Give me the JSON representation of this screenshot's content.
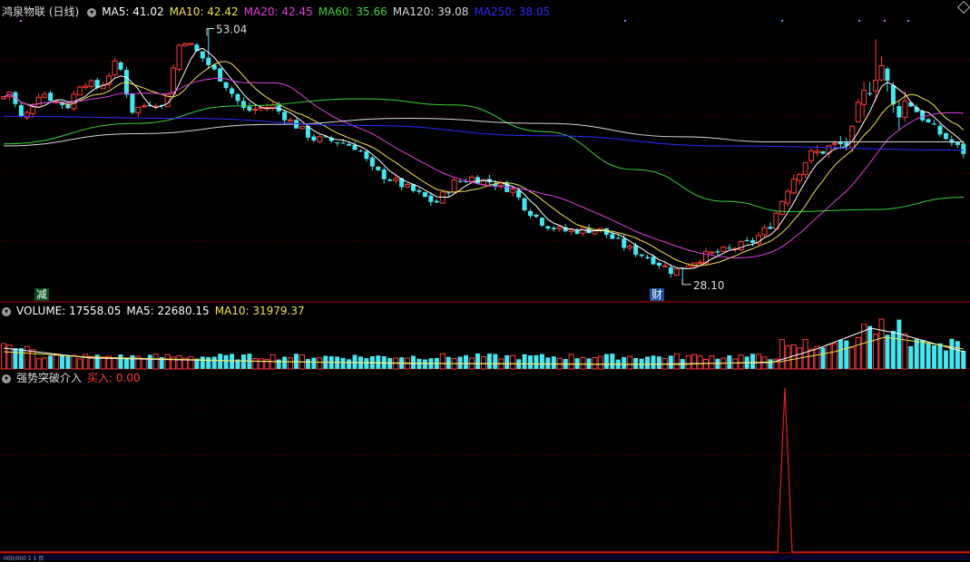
{
  "main": {
    "title": "鸿泉物联 (日线)",
    "ma": [
      {
        "label": "MA5: 41.02",
        "color": "#ffffff"
      },
      {
        "label": "MA10: 42.42",
        "color": "#f2e24a"
      },
      {
        "label": "MA20: 42.45",
        "color": "#e040e0"
      },
      {
        "label": "MA60: 35.66",
        "color": "#35d335"
      },
      {
        "label": "MA120: 39.08",
        "color": "#d8d8d8"
      },
      {
        "label": "MA250: 38.05",
        "color": "#2b2bff"
      }
    ],
    "high_label": "53.04",
    "low_label": "28.10",
    "badge_jian": "减",
    "badge_cai": "财"
  },
  "volume": {
    "labels": [
      {
        "label": "VOLUME: 17558.05",
        "color": "#ffffff"
      },
      {
        "label": "MA5: 22680.15",
        "color": "#ffffff"
      },
      {
        "label": "MA10: 31979.37",
        "color": "#f2e24a"
      }
    ]
  },
  "indicator": {
    "name": "强势突破介入",
    "signal": "买入: 0.00"
  },
  "bottom_strip": "000/000 1 1 页",
  "colors": {
    "up": "#ff3b3b",
    "down": "#46e6f0",
    "grid": "#7a0000"
  }
}
